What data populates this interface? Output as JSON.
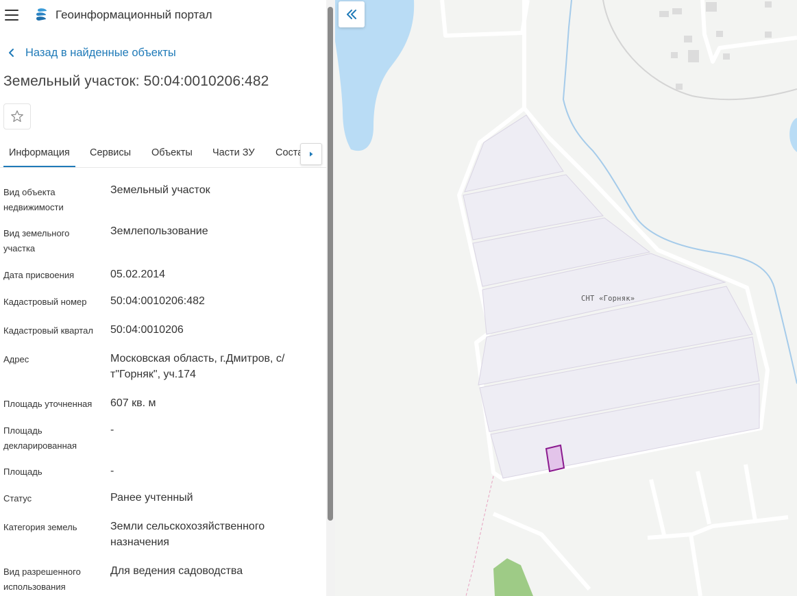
{
  "header": {
    "title": "Геоинформационный портал",
    "menu_icon": "hamburger-menu-icon",
    "logo_icon": "portal-logo-icon"
  },
  "back_link": {
    "label": "Назад в найденные объекты",
    "icon": "chevron-left-icon"
  },
  "object": {
    "title": "Земельный участок: 50:04:0010206:482"
  },
  "favorite": {
    "icon": "star-outline-icon"
  },
  "tabs": [
    {
      "label": "Информация",
      "active": true
    },
    {
      "label": "Сервисы",
      "active": false
    },
    {
      "label": "Объекты",
      "active": false
    },
    {
      "label": "Части ЗУ",
      "active": false
    },
    {
      "label": "Соста",
      "active": false
    }
  ],
  "tabs_scroll_icon": "caret-right-icon",
  "info": [
    {
      "label_lines": [
        "Вид объекта",
        "недвижимости"
      ],
      "value_lines": [
        "Земельный участок"
      ]
    },
    {
      "label_lines": [
        "Вид земельного",
        "участка"
      ],
      "value_lines": [
        "Землепользование"
      ]
    },
    {
      "label_lines": [
        "Дата присвоения"
      ],
      "value_lines": [
        "05.02.2014"
      ]
    },
    {
      "label_lines": [
        "Кадастровый номер"
      ],
      "value_lines": [
        "50:04:0010206:482"
      ]
    },
    {
      "label_lines": [
        "Кадастровый квартал"
      ],
      "value_lines": [
        "50:04:0010206"
      ]
    },
    {
      "label_lines": [
        "Адрес"
      ],
      "value_lines": [
        "Московская область, г.Дмитров, с/",
        "т\"Горняк\", уч.174"
      ]
    },
    {
      "label_lines": [
        "Площадь уточненная"
      ],
      "value_lines": [
        "607 кв. м"
      ]
    },
    {
      "label_lines": [
        "Площадь",
        "декларированная"
      ],
      "value_lines": [
        "-"
      ]
    },
    {
      "label_lines": [
        "Площадь"
      ],
      "value_lines": [
        "-"
      ]
    },
    {
      "label_lines": [
        "Статус"
      ],
      "value_lines": [
        "Ранее учтенный"
      ]
    },
    {
      "label_lines": [
        "Категория земель"
      ],
      "value_lines": [
        "Земли сельскохозяйственного",
        "назначения"
      ]
    },
    {
      "label_lines": [
        "Вид разрешенного",
        "использования"
      ],
      "value_lines": [
        "Для ведения садоводства"
      ]
    }
  ],
  "map": {
    "collapse_icon": "double-chevron-left-icon",
    "area_label": "СНТ «Горняк»",
    "colors": {
      "background": "#f3f4f2",
      "water": "#b9dcf5",
      "plot_fill": "#eeedf4",
      "highlight_fill": "#e3c4ea",
      "highlight_stroke": "#8a1a8e",
      "green": "#9ecb86"
    }
  },
  "colors": {
    "accent": "#1f7ab8",
    "text": "#333333"
  }
}
